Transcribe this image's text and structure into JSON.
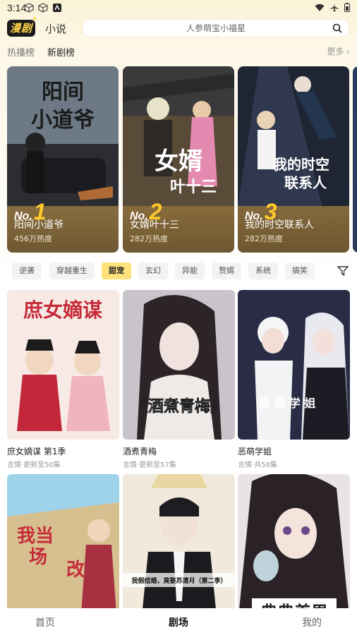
{
  "status": {
    "time": "3:14"
  },
  "header": {
    "logo": "漫剧",
    "novel_tab": "小说",
    "search_placeholder": "人参萌宝小福星"
  },
  "rank_tabs": {
    "hot": "热播榜",
    "new": "新剧榜",
    "more": "更多"
  },
  "rank_cards": [
    {
      "no_prefix": "No.",
      "rank": "1",
      "title": "阳间小道爷",
      "heat": "456万热度"
    },
    {
      "no_prefix": "No.",
      "rank": "2",
      "title": "女婿叶十三",
      "heat": "282万热度"
    },
    {
      "no_prefix": "No.",
      "rank": "3",
      "title": "我的时空联系人",
      "heat": "282万热度"
    }
  ],
  "categories": [
    "逆袭",
    "穿越重生",
    "甜宠",
    "玄幻",
    "异能",
    "赘婿",
    "系统",
    "搞笑"
  ],
  "active_category": "甜宠",
  "grid": [
    {
      "title": "庶女嫡谋 第1季",
      "sub": "言情·更新至50集"
    },
    {
      "title": "酒煮青梅",
      "sub": "言情·更新至57集"
    },
    {
      "title": "恶萌学姐",
      "sub": "言情·共58集"
    },
    {
      "title": "",
      "sub": ""
    },
    {
      "title": "",
      "sub": ""
    },
    {
      "title": "",
      "sub": ""
    }
  ],
  "nav": {
    "home": "首页",
    "theater": "剧场",
    "mine": "我的"
  },
  "colors": {
    "accent": "#ffe27a",
    "rank_gold": "#ffc92a"
  }
}
